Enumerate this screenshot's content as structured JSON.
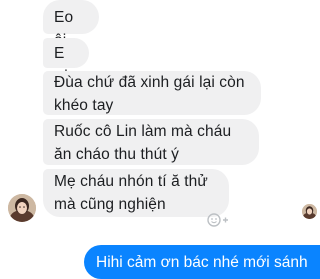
{
  "messages": {
    "received": [
      {
        "text": "Eo ôi"
      },
      {
        "text": "E ơi"
      },
      {
        "text": "Đùa chứ đã xinh gái lại còn khéo tay"
      },
      {
        "text": "Ruốc cô Lin làm mà cháu ăn cháo thu thút ý"
      },
      {
        "text": "Mẹ cháu nhón tí ă thử mà cũng nghiện"
      }
    ],
    "sent": [
      {
        "text": "Hihi cảm ơn bác nhé mới sánh"
      }
    ]
  },
  "icons": {
    "react": "emoji-plus-icon",
    "sender_avatar": "avatar",
    "read_receipt": "read-receipt-avatar"
  },
  "colors": {
    "received_bubble": "#f0f0f1",
    "sent_bubble": "#0a84ff",
    "text": "#1c1e21",
    "sent_text": "#ffffff"
  }
}
